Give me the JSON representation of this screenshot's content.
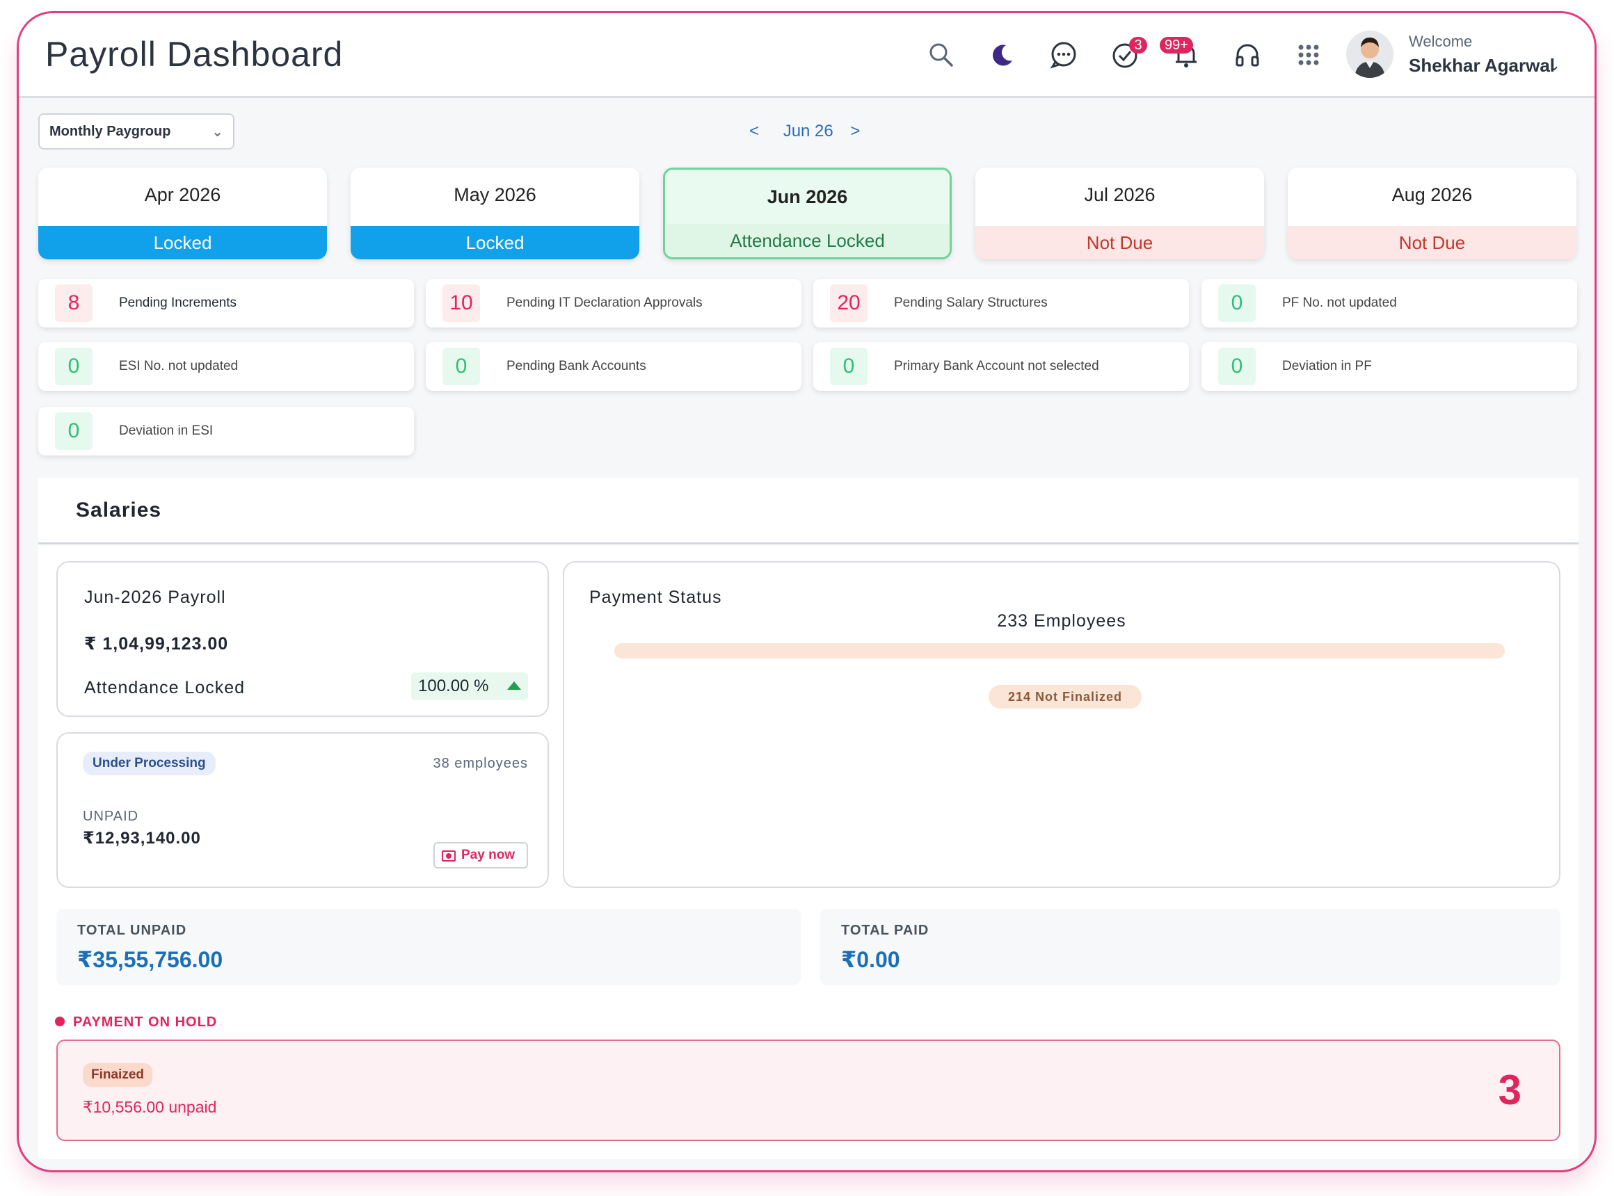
{
  "header": {
    "title": "Payroll Dashboard",
    "tasks_badge": "3",
    "notifications_badge": "99+",
    "welcome": "Welcome",
    "user_name": "Shekhar Agarwal"
  },
  "paygroup": {
    "selected": "Monthly Paygroup"
  },
  "month_nav": {
    "current": "Jun 26",
    "prev": "<",
    "next": ">"
  },
  "months": [
    {
      "name": "Apr 2026",
      "status": "Locked"
    },
    {
      "name": "May 2026",
      "status": "Locked"
    },
    {
      "name": "Jun 2026",
      "status": "Attendance Locked"
    },
    {
      "name": "Jul 2026",
      "status": "Not Due"
    },
    {
      "name": "Aug 2026",
      "status": "Not Due"
    }
  ],
  "alerts": [
    {
      "count": "8",
      "label": "Pending Increments"
    },
    {
      "count": "10",
      "label": "Pending IT Declaration Approvals"
    },
    {
      "count": "20",
      "label": "Pending Salary Structures"
    },
    {
      "count": "0",
      "label": "PF No. not updated"
    },
    {
      "count": "0",
      "label": "ESI No. not updated"
    },
    {
      "count": "0",
      "label": "Pending Bank Accounts"
    },
    {
      "count": "0",
      "label": "Primary Bank Account not selected"
    },
    {
      "count": "0",
      "label": "Deviation in PF"
    },
    {
      "count": "0",
      "label": "Deviation in ESI"
    }
  ],
  "salaries": {
    "title": "Salaries",
    "payroll": {
      "title": "Jun-2026 Payroll",
      "amount": "₹ 1,04,99,123.00",
      "status": "Attendance Locked",
      "percent": "100.00 %"
    },
    "processing": {
      "tag": "Under Processing",
      "employees": "38 employees",
      "unpaid_label": "UNPAID",
      "unpaid_amount": "₹12,93,140.00",
      "pay_now": "Pay now"
    },
    "payment_status": {
      "title": "Payment Status",
      "employees": "233 Employees",
      "not_finalized": "214 Not Finalized"
    },
    "total_unpaid": {
      "label": "TOTAL UNPAID",
      "value": "₹35,55,756.00"
    },
    "total_paid": {
      "label": "TOTAL PAID",
      "value": "₹0.00"
    },
    "on_hold": {
      "label": "PAYMENT ON HOLD",
      "tag": "Finaized",
      "amount": "₹10,556.00 unpaid",
      "count": "3"
    }
  },
  "colors": {
    "accent": "#e0245e",
    "locked": "#11a0ea",
    "attendance_locked": "#dff6e7",
    "not_due": "#fde6e6",
    "value_blue": "#1a6fb6"
  }
}
